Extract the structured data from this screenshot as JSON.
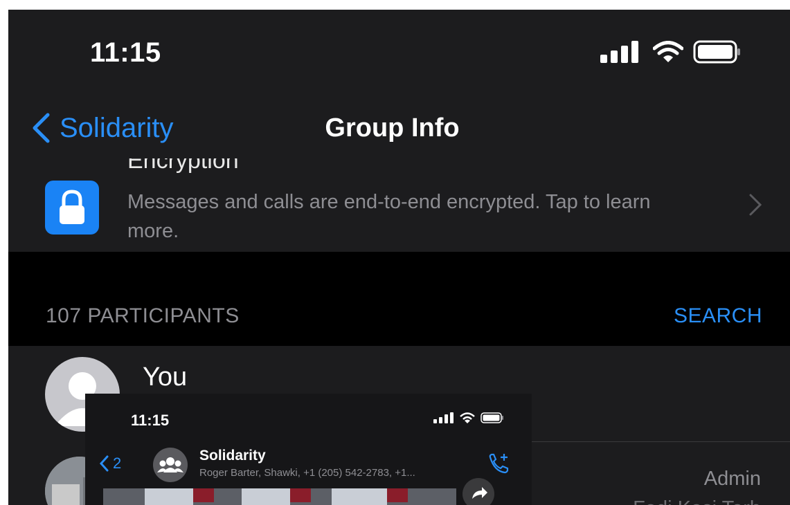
{
  "status_bar": {
    "time": "11:15",
    "icons": [
      "signal-icon",
      "wifi-icon",
      "battery-icon"
    ]
  },
  "nav": {
    "back_label": "Solidarity",
    "title": "Group Info"
  },
  "encryption": {
    "title": "Encryption",
    "description": "Messages and calls are end-to-end encrypted. Tap to learn more."
  },
  "participants": {
    "count_label": "107 PARTICIPANTS",
    "search_label": "SEARCH"
  },
  "members": [
    {
      "name": "You"
    },
    {
      "role": "Admin",
      "subtitle": "Fadi Kasi Tarb"
    }
  ],
  "inset": {
    "time": "11:15",
    "back_count": "2",
    "chat_title": "Solidarity",
    "chat_subtitle": "Roger Barter, Shawki, +1 (205) 542-2783, +1..."
  },
  "colors": {
    "accent": "#2a8ff7",
    "background": "#1c1c1e",
    "lock_tile": "#1a83f5"
  }
}
